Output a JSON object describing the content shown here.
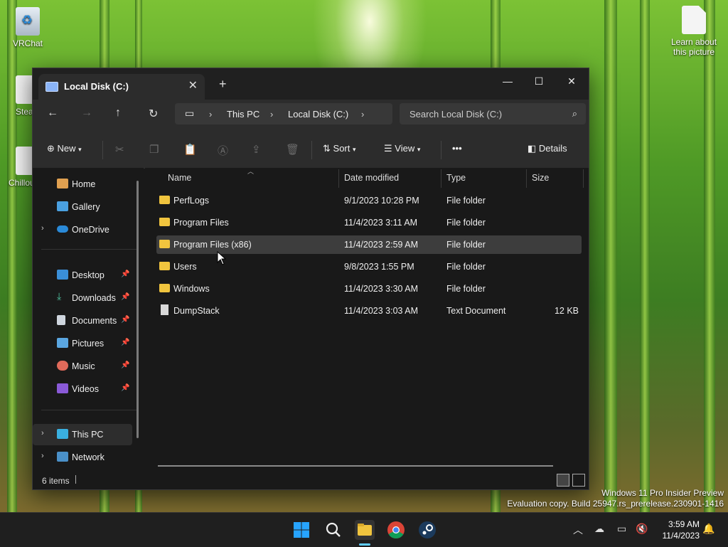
{
  "desktop": {
    "icons": [
      {
        "label": "VRChat"
      },
      {
        "label": "Stea"
      },
      {
        "label": "Chillou"
      },
      {
        "label": "Learn about this picture"
      }
    ]
  },
  "window": {
    "tab_title": "Local Disk (C:)",
    "breadcrumbs": [
      "This PC",
      "Local Disk (C:)"
    ],
    "search_placeholder": "Search Local Disk (C:)",
    "toolbar": {
      "new": "New",
      "sort": "Sort",
      "view": "View",
      "more": "•••",
      "details": "Details"
    },
    "sidebar": {
      "top": [
        {
          "label": "Home"
        },
        {
          "label": "Gallery"
        },
        {
          "label": "OneDrive"
        }
      ],
      "quick": [
        {
          "label": "Desktop"
        },
        {
          "label": "Downloads"
        },
        {
          "label": "Documents"
        },
        {
          "label": "Pictures"
        },
        {
          "label": "Music"
        },
        {
          "label": "Videos"
        }
      ],
      "bottom": [
        {
          "label": "This PC"
        },
        {
          "label": "Network"
        }
      ]
    },
    "columns": {
      "name": "Name",
      "date": "Date modified",
      "type": "Type",
      "size": "Size"
    },
    "rows": [
      {
        "name": "PerfLogs",
        "date": "9/1/2023 10:28 PM",
        "type": "File folder",
        "size": ""
      },
      {
        "name": "Program Files",
        "date": "11/4/2023 3:11 AM",
        "type": "File folder",
        "size": ""
      },
      {
        "name": "Program Files (x86)",
        "date": "11/4/2023 2:59 AM",
        "type": "File folder",
        "size": ""
      },
      {
        "name": "Users",
        "date": "9/8/2023 1:55 PM",
        "type": "File folder",
        "size": ""
      },
      {
        "name": "Windows",
        "date": "11/4/2023 3:30 AM",
        "type": "File folder",
        "size": ""
      },
      {
        "name": "DumpStack",
        "date": "11/4/2023 3:03 AM",
        "type": "Text Document",
        "size": "12 KB"
      }
    ],
    "status": "6 items"
  },
  "watermark": {
    "line1": "Windows 11 Pro Insider Preview",
    "line2": "Evaluation copy. Build 25947.rs_prerelease.230901-1416"
  },
  "taskbar": {
    "time": "3:59 AM",
    "date": "11/4/2023"
  },
  "colors": {
    "accent": "#0078d4",
    "folder": "#f0c43e",
    "window_bg": "#191919"
  }
}
